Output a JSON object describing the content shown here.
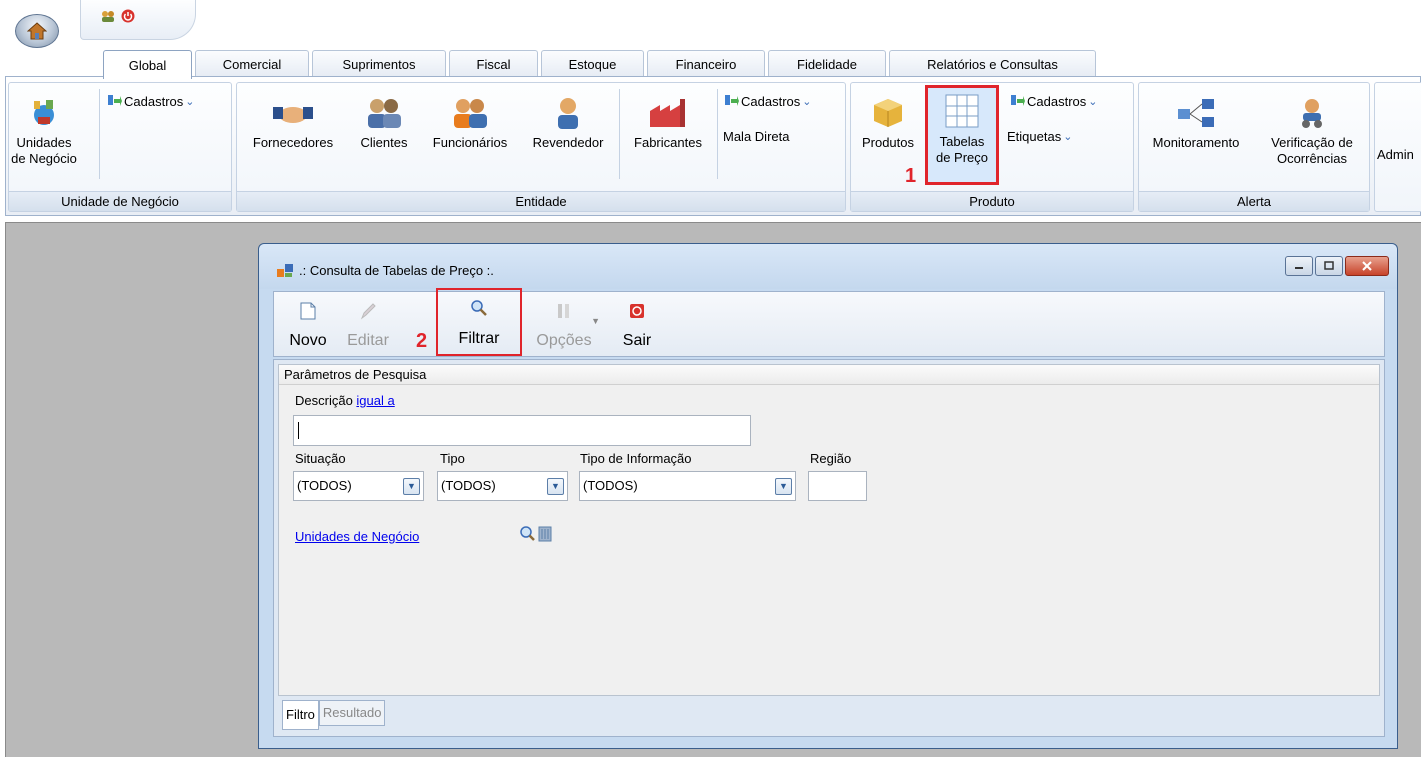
{
  "tabs": [
    "Global",
    "Comercial",
    "Suprimentos",
    "Fiscal",
    "Estoque",
    "Financeiro",
    "Fidelidade",
    "Relatórios e Consultas"
  ],
  "ribbon": {
    "group_unidade": {
      "label": "Unidade de Negócio",
      "unidades_label_1": "Unidades",
      "unidades_label_2": "de Negócio",
      "cadastros": "Cadastros"
    },
    "group_entidade": {
      "label": "Entidade",
      "fornecedores": "Fornecedores",
      "clientes": "Clientes",
      "funcionarios": "Funcionários",
      "revendedor": "Revendedor",
      "fabricantes": "Fabricantes",
      "cadastros": "Cadastros",
      "mala_direta": "Mala Direta"
    },
    "group_produto": {
      "label": "Produto",
      "produtos": "Produtos",
      "tabelas_1": "Tabelas",
      "tabelas_2": "de Preço",
      "cadastros": "Cadastros",
      "etiquetas": "Etiquetas"
    },
    "group_alerta": {
      "label": "Alerta",
      "monitoramento": "Monitoramento",
      "verificacao_1": "Verificação de",
      "verificacao_2": "Ocorrências"
    },
    "admin_truncated": "Admin"
  },
  "annotations": {
    "step1": "1",
    "step2": "2"
  },
  "dialog": {
    "title": ".: Consulta de Tabelas de Preço :.",
    "toolbar": {
      "novo": "Novo",
      "editar": "Editar",
      "filtrar": "Filtrar",
      "opcoes": "Opções",
      "sair": "Sair"
    },
    "panel_title": "Parâmetros de Pesquisa",
    "descricao_label": "Descrição",
    "descricao_operator": "igual a",
    "descricao_value": "",
    "situacao_label": "Situação",
    "situacao_value": "(TODOS)",
    "tipo_label": "Tipo",
    "tipo_value": "(TODOS)",
    "tipo_info_label": "Tipo de Informação",
    "tipo_info_value": "(TODOS)",
    "regiao_label": "Região",
    "regiao_value": "",
    "unidades_link": "Unidades de Negócio",
    "bottom_tabs": [
      "Filtro",
      "Resultado"
    ]
  }
}
